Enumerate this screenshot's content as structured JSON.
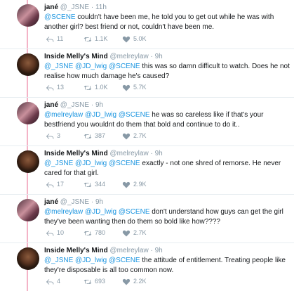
{
  "tweets": [
    {
      "author": "jane",
      "name": "jané",
      "handle": "@_JSNE",
      "time": "11h",
      "text": [
        {
          "t": "@SCENE",
          "m": true
        },
        {
          "t": " couldn't have been me, he told you to get out while he was with another girl? best friend or not, couldn't have been me.",
          "m": false
        }
      ],
      "replies": "11",
      "retweets": "1.1K",
      "likes": "5.0K"
    },
    {
      "author": "melly",
      "name": "Inside Melly's Mind",
      "handle": "@melreylaw",
      "time": "9h",
      "text": [
        {
          "t": "@_JSNE @JD_lwig @SCENE",
          "m": true
        },
        {
          "t": " this was so damn difficult to watch. Does he not realise how much damage he's caused?",
          "m": false
        }
      ],
      "replies": "13",
      "retweets": "1.0K",
      "likes": "5.7K"
    },
    {
      "author": "jane",
      "name": "jané",
      "handle": "@_JSNE",
      "time": "9h",
      "text": [
        {
          "t": "@melreylaw @JD_lwig @SCENE",
          "m": true
        },
        {
          "t": " he was so careless like if that's your bestfriend you wouldnt do them that bold and continue to do it..",
          "m": false
        }
      ],
      "replies": "3",
      "retweets": "387",
      "likes": "2.7K"
    },
    {
      "author": "melly",
      "name": "Inside Melly's Mind",
      "handle": "@melreylaw",
      "time": "9h",
      "text": [
        {
          "t": "@_JSNE @JD_lwig @SCENE",
          "m": true
        },
        {
          "t": " exactly - not one shred of remorse. He never cared for that girl.",
          "m": false
        }
      ],
      "replies": "17",
      "retweets": "344",
      "likes": "2.9K"
    },
    {
      "author": "jane",
      "name": "jané",
      "handle": "@_JSNE",
      "time": "9h",
      "text": [
        {
          "t": "@melreylaw @JD_lwig @SCENE",
          "m": true
        },
        {
          "t": " don't understand how guys can get the girl they've been wanting then do them so bold like how????",
          "m": false
        }
      ],
      "replies": "10",
      "retweets": "780",
      "likes": "2.7K"
    },
    {
      "author": "melly",
      "name": "Inside Melly's Mind",
      "handle": "@melreylaw",
      "time": "9h",
      "text": [
        {
          "t": "@_JSNE @JD_lwig @SCENE",
          "m": true
        },
        {
          "t": " the attitude of entitlement. Treating people like they're disposable is all too common now.",
          "m": false
        }
      ],
      "replies": "4",
      "retweets": "693",
      "likes": "2.2K"
    }
  ],
  "icons": {
    "reply": "reply-icon",
    "retweet": "retweet-icon",
    "like": "heart-icon"
  },
  "colors": {
    "mention": "#1b95e0",
    "thread_line": "#e0245e",
    "muted": "#8899a6"
  }
}
